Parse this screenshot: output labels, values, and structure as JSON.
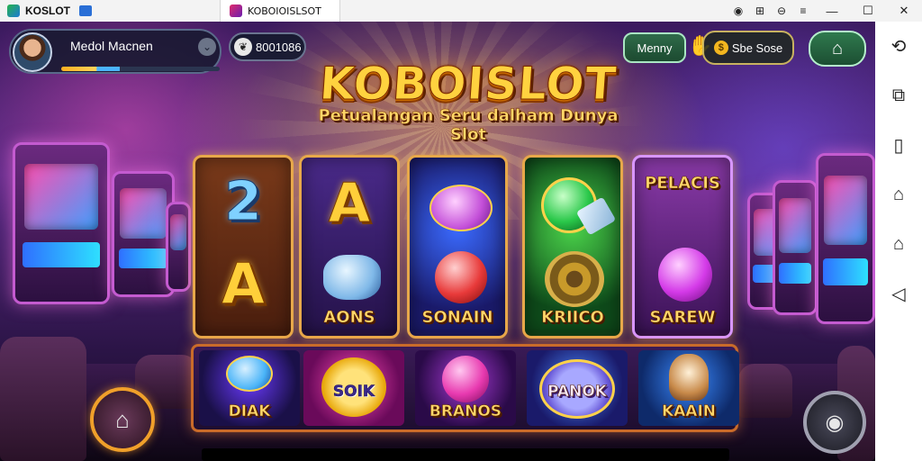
{
  "titlebar": {
    "app_name": "KOSLOT",
    "tab_label": "KOBOIOISLSOT",
    "controls": [
      "◉",
      "⊞",
      "⊖",
      "≡"
    ],
    "window_controls": [
      "—",
      "☐",
      "✕"
    ]
  },
  "player": {
    "name": "Medol Macnen",
    "xp_fraction": 0.37
  },
  "coins": {
    "icon": "❦",
    "value": "8001086"
  },
  "buttons": {
    "menu": "Menny",
    "score": "Sbe Sose",
    "score_coin": "$"
  },
  "logo": {
    "title": "KOBOISLOT",
    "subtitle": "Petualangan Seru dalham Dunya Slot"
  },
  "reels": [
    {
      "top": "2",
      "bottom": "A",
      "label": ""
    },
    {
      "top": "A",
      "bottom": "",
      "label": "AONS"
    },
    {
      "top": "",
      "bottom": "",
      "label": "SONAIN"
    },
    {
      "top": "",
      "bottom": "",
      "label": "KRIICO"
    },
    {
      "top": "PELACIS",
      "bottom": "",
      "label": "SAREW"
    }
  ],
  "tiles": [
    "DIAK",
    "SOIK",
    "BRANOS",
    "PANOK",
    "KAAIN"
  ],
  "sidebar": [
    "⟲",
    "⧉",
    "▯",
    "⌂",
    "⌂",
    "◁"
  ],
  "colors": {
    "accent": "#ffd23f",
    "frame": "#e7a84a",
    "menu_green": "#2f6b4a"
  }
}
